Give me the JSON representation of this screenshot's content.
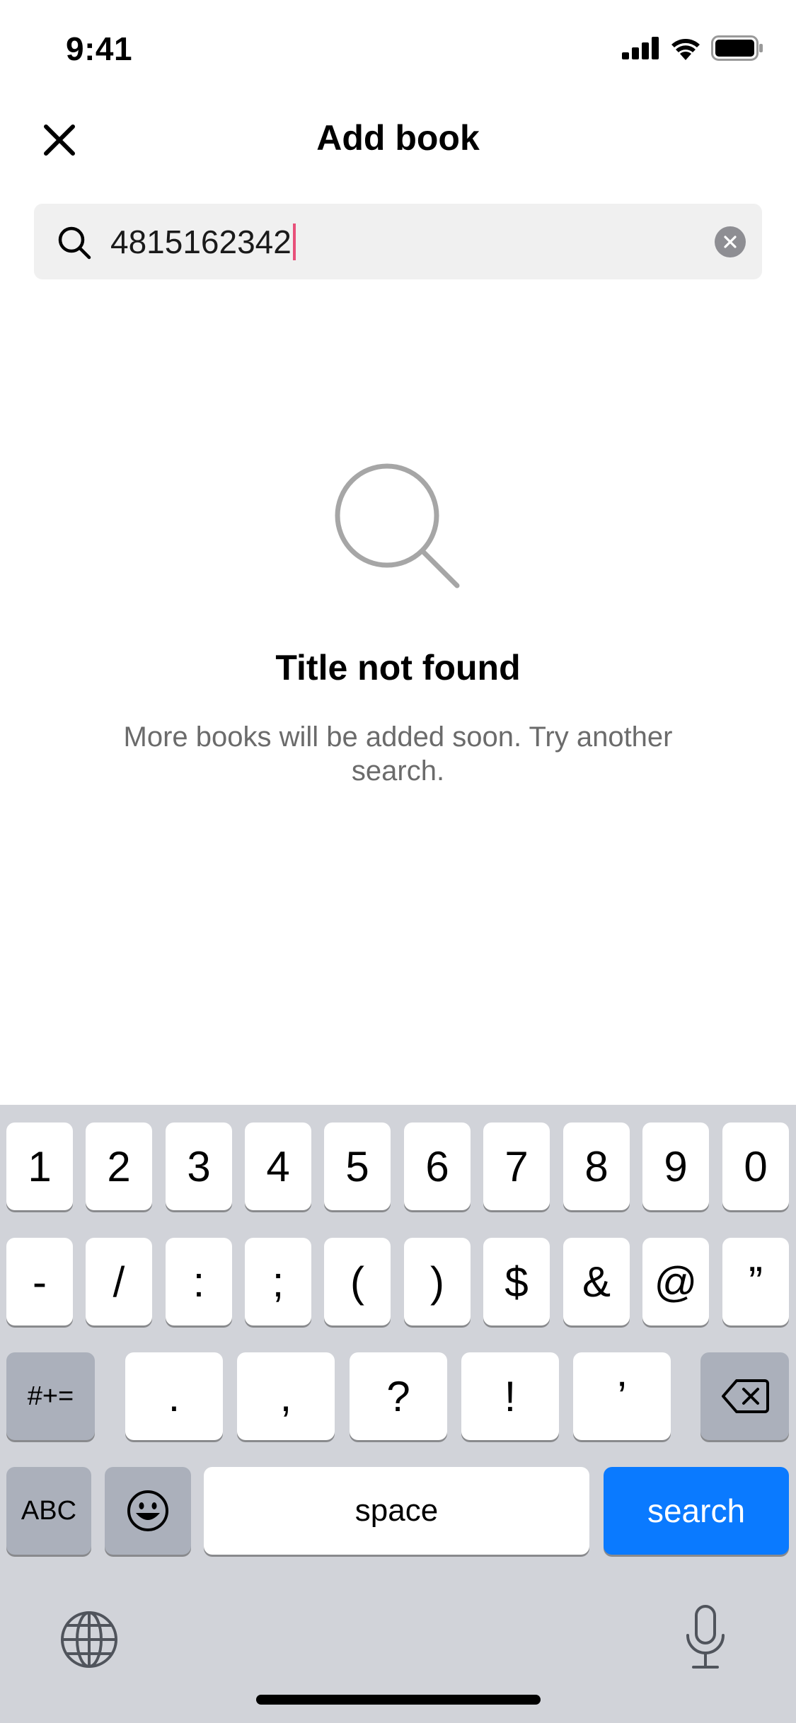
{
  "status_bar": {
    "time": "9:41"
  },
  "header": {
    "title": "Add book"
  },
  "search": {
    "value": "4815162342"
  },
  "empty_state": {
    "title": "Title not found",
    "description": "More books will be added soon. Try another search."
  },
  "keyboard": {
    "row1": [
      "1",
      "2",
      "3",
      "4",
      "5",
      "6",
      "7",
      "8",
      "9",
      "0"
    ],
    "row2": [
      "-",
      "/",
      ":",
      ";",
      "(",
      ")",
      "$",
      "&",
      "@",
      "”"
    ],
    "row3": {
      "symbols_toggle": "#+=",
      "keys": [
        ".",
        ",",
        "?",
        "!",
        "’"
      ]
    },
    "row4": {
      "abc": "ABC",
      "space": "space",
      "search": "search"
    }
  },
  "colors": {
    "caret": "#e8507a",
    "search_key": "#0a7aff",
    "keyboard_bg": "#d1d3d9"
  },
  "icons": [
    "signal-icon",
    "wifi-icon",
    "battery-icon",
    "close-icon",
    "search-icon",
    "clear-icon",
    "emoji-icon",
    "backspace-icon",
    "globe-icon",
    "microphone-icon"
  ]
}
